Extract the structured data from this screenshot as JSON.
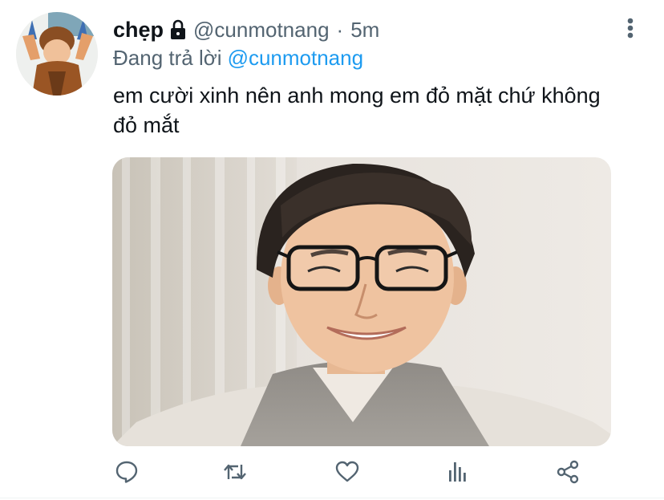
{
  "tweet": {
    "display_name": "chẹp",
    "handle": "@cunmotnang",
    "separator": "·",
    "time": "5m",
    "reply_prefix": "Đang trả lời",
    "reply_to": "@cunmotnang",
    "text": "em cười xinh nên anh mong em đỏ mặt chứ không đỏ mắt"
  },
  "icons": {
    "protected": "lock-icon",
    "more": "more-vertical-icon",
    "actions": [
      "reply-icon",
      "retweet-icon",
      "like-icon",
      "analytics-icon",
      "share-icon"
    ]
  },
  "colors": {
    "link": "#1d9bf0",
    "secondary_text": "#536471",
    "primary_text": "#0f1419"
  }
}
